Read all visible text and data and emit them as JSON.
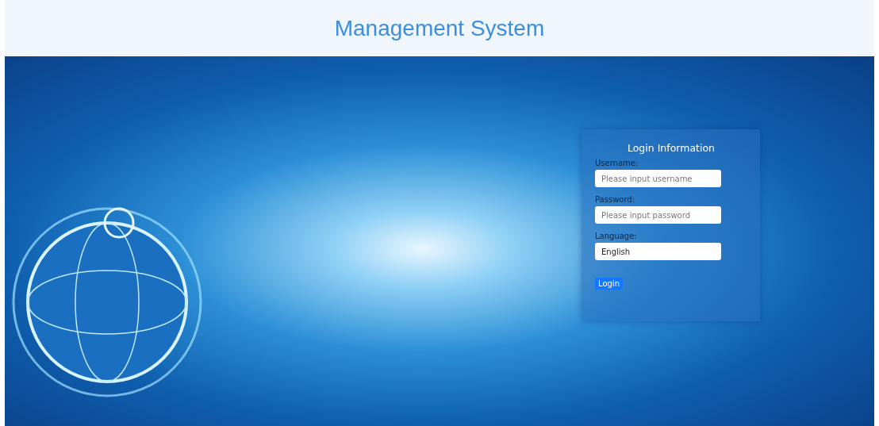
{
  "header": {
    "title": "Management System"
  },
  "login": {
    "title": "Login Information",
    "fields": [
      {
        "kind": "text",
        "label": "Username:",
        "placeholder": "Please input username"
      },
      {
        "kind": "password",
        "label": "Password:",
        "placeholder": "Please input password"
      },
      {
        "kind": "select",
        "label": "Language:",
        "value": "English"
      }
    ],
    "button": "Login"
  }
}
